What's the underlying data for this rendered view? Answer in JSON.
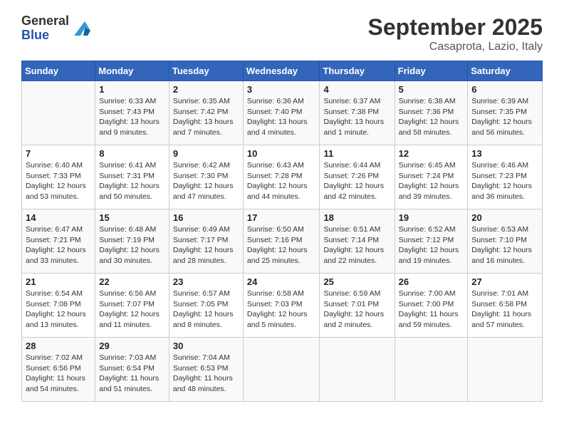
{
  "header": {
    "logo_general": "General",
    "logo_blue": "Blue",
    "title": "September 2025",
    "subtitle": "Casaprota, Lazio, Italy"
  },
  "days_of_week": [
    "Sunday",
    "Monday",
    "Tuesday",
    "Wednesday",
    "Thursday",
    "Friday",
    "Saturday"
  ],
  "weeks": [
    [
      {
        "day": "",
        "info": ""
      },
      {
        "day": "1",
        "info": "Sunrise: 6:33 AM\nSunset: 7:43 PM\nDaylight: 13 hours\nand 9 minutes."
      },
      {
        "day": "2",
        "info": "Sunrise: 6:35 AM\nSunset: 7:42 PM\nDaylight: 13 hours\nand 7 minutes."
      },
      {
        "day": "3",
        "info": "Sunrise: 6:36 AM\nSunset: 7:40 PM\nDaylight: 13 hours\nand 4 minutes."
      },
      {
        "day": "4",
        "info": "Sunrise: 6:37 AM\nSunset: 7:38 PM\nDaylight: 13 hours\nand 1 minute."
      },
      {
        "day": "5",
        "info": "Sunrise: 6:38 AM\nSunset: 7:36 PM\nDaylight: 12 hours\nand 58 minutes."
      },
      {
        "day": "6",
        "info": "Sunrise: 6:39 AM\nSunset: 7:35 PM\nDaylight: 12 hours\nand 56 minutes."
      }
    ],
    [
      {
        "day": "7",
        "info": "Sunrise: 6:40 AM\nSunset: 7:33 PM\nDaylight: 12 hours\nand 53 minutes."
      },
      {
        "day": "8",
        "info": "Sunrise: 6:41 AM\nSunset: 7:31 PM\nDaylight: 12 hours\nand 50 minutes."
      },
      {
        "day": "9",
        "info": "Sunrise: 6:42 AM\nSunset: 7:30 PM\nDaylight: 12 hours\nand 47 minutes."
      },
      {
        "day": "10",
        "info": "Sunrise: 6:43 AM\nSunset: 7:28 PM\nDaylight: 12 hours\nand 44 minutes."
      },
      {
        "day": "11",
        "info": "Sunrise: 6:44 AM\nSunset: 7:26 PM\nDaylight: 12 hours\nand 42 minutes."
      },
      {
        "day": "12",
        "info": "Sunrise: 6:45 AM\nSunset: 7:24 PM\nDaylight: 12 hours\nand 39 minutes."
      },
      {
        "day": "13",
        "info": "Sunrise: 6:46 AM\nSunset: 7:23 PM\nDaylight: 12 hours\nand 36 minutes."
      }
    ],
    [
      {
        "day": "14",
        "info": "Sunrise: 6:47 AM\nSunset: 7:21 PM\nDaylight: 12 hours\nand 33 minutes."
      },
      {
        "day": "15",
        "info": "Sunrise: 6:48 AM\nSunset: 7:19 PM\nDaylight: 12 hours\nand 30 minutes."
      },
      {
        "day": "16",
        "info": "Sunrise: 6:49 AM\nSunset: 7:17 PM\nDaylight: 12 hours\nand 28 minutes."
      },
      {
        "day": "17",
        "info": "Sunrise: 6:50 AM\nSunset: 7:16 PM\nDaylight: 12 hours\nand 25 minutes."
      },
      {
        "day": "18",
        "info": "Sunrise: 6:51 AM\nSunset: 7:14 PM\nDaylight: 12 hours\nand 22 minutes."
      },
      {
        "day": "19",
        "info": "Sunrise: 6:52 AM\nSunset: 7:12 PM\nDaylight: 12 hours\nand 19 minutes."
      },
      {
        "day": "20",
        "info": "Sunrise: 6:53 AM\nSunset: 7:10 PM\nDaylight: 12 hours\nand 16 minutes."
      }
    ],
    [
      {
        "day": "21",
        "info": "Sunrise: 6:54 AM\nSunset: 7:08 PM\nDaylight: 12 hours\nand 13 minutes."
      },
      {
        "day": "22",
        "info": "Sunrise: 6:56 AM\nSunset: 7:07 PM\nDaylight: 12 hours\nand 11 minutes."
      },
      {
        "day": "23",
        "info": "Sunrise: 6:57 AM\nSunset: 7:05 PM\nDaylight: 12 hours\nand 8 minutes."
      },
      {
        "day": "24",
        "info": "Sunrise: 6:58 AM\nSunset: 7:03 PM\nDaylight: 12 hours\nand 5 minutes."
      },
      {
        "day": "25",
        "info": "Sunrise: 6:59 AM\nSunset: 7:01 PM\nDaylight: 12 hours\nand 2 minutes."
      },
      {
        "day": "26",
        "info": "Sunrise: 7:00 AM\nSunset: 7:00 PM\nDaylight: 11 hours\nand 59 minutes."
      },
      {
        "day": "27",
        "info": "Sunrise: 7:01 AM\nSunset: 6:58 PM\nDaylight: 11 hours\nand 57 minutes."
      }
    ],
    [
      {
        "day": "28",
        "info": "Sunrise: 7:02 AM\nSunset: 6:56 PM\nDaylight: 11 hours\nand 54 minutes."
      },
      {
        "day": "29",
        "info": "Sunrise: 7:03 AM\nSunset: 6:54 PM\nDaylight: 11 hours\nand 51 minutes."
      },
      {
        "day": "30",
        "info": "Sunrise: 7:04 AM\nSunset: 6:53 PM\nDaylight: 11 hours\nand 48 minutes."
      },
      {
        "day": "",
        "info": ""
      },
      {
        "day": "",
        "info": ""
      },
      {
        "day": "",
        "info": ""
      },
      {
        "day": "",
        "info": ""
      }
    ]
  ]
}
